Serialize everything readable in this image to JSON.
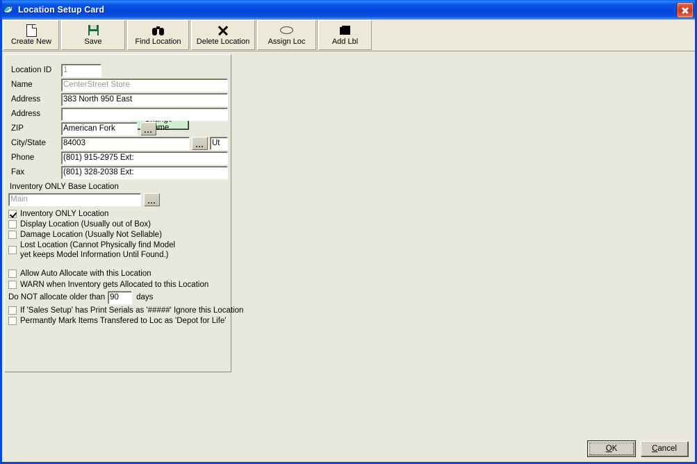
{
  "window": {
    "title": "Location Setup Card",
    "icon": "bird-icon",
    "close_label": "Close"
  },
  "toolbar": {
    "buttons": [
      {
        "label": "Create New",
        "icon": "new-document-icon"
      },
      {
        "label": "Save",
        "icon": "floppy-disk-icon"
      },
      {
        "label": "Find Location",
        "icon": "binoculars-icon"
      },
      {
        "label": "Delete Location",
        "icon": "x-cross-icon"
      },
      {
        "label": "Assign Loc",
        "icon": "oval-icon"
      },
      {
        "label": "Add Lbl",
        "icon": "label-icon"
      }
    ]
  },
  "form": {
    "change_name_button": {
      "accel": "C",
      "label_rest": "hange Name"
    },
    "fields": [
      {
        "label": "Location ID",
        "value": "1",
        "disabled": true
      },
      {
        "label": "Name",
        "value": "CenterStreet Store",
        "disabled": true
      },
      {
        "label": "Address",
        "value": "383 North 950 East",
        "disabled": false
      },
      {
        "label": "Address",
        "value": "",
        "disabled": false
      },
      {
        "label": "ZIP",
        "value": "American Fork",
        "disabled": false
      },
      {
        "label": "City/State",
        "value": "84003",
        "disabled": false
      },
      {
        "label": "Phone",
        "value": "(801) 915-2975 Ext:",
        "disabled": false
      },
      {
        "label": "Fax",
        "value": "(801) 328-2038 Ext:",
        "disabled": false
      }
    ],
    "state_value": "Ut",
    "base_location": {
      "label": "Inventory ONLY Base Location",
      "value": "Main"
    },
    "checkboxes_group_1": [
      {
        "label": "Inventory ONLY Location",
        "checked": true
      },
      {
        "label": "Display Location (Usually out of Box)",
        "checked": false
      },
      {
        "label": "Damage Location (Usually Not Sellable)",
        "checked": false
      },
      {
        "label": "Lost Location (Cannot Physically find Model yet keeps Model Information Until Found.)",
        "checked": false
      }
    ],
    "checkboxes_group_2": [
      {
        "label": "Allow Auto Allocate with this Location",
        "checked": false
      },
      {
        "label": "WARN when Inventory gets Allocated to this Location",
        "checked": false
      }
    ],
    "allocate_age": {
      "prefix": "Do NOT allocate older than",
      "days": "90",
      "suffix": "days"
    },
    "checkboxes_group_3": [
      {
        "label": "If 'Sales Setup' has Print Serials as '#####' Ignore this Location",
        "checked": false
      },
      {
        "label": "Permantly Mark Items Transfered to Loc as 'Depot for Life'",
        "checked": false
      }
    ],
    "ellipsis_label": "..."
  },
  "footer": {
    "ok": {
      "accel": "O",
      "label_rest": "K"
    },
    "cancel": {
      "accel": "C",
      "label_rest": "ancel"
    }
  },
  "colors": {
    "title_blue": "#0046d8",
    "face": "#e9e8dc",
    "toolbar_face": "#ece9d8",
    "green_button": "#cdf0cd",
    "close_red": "#c6341c"
  }
}
